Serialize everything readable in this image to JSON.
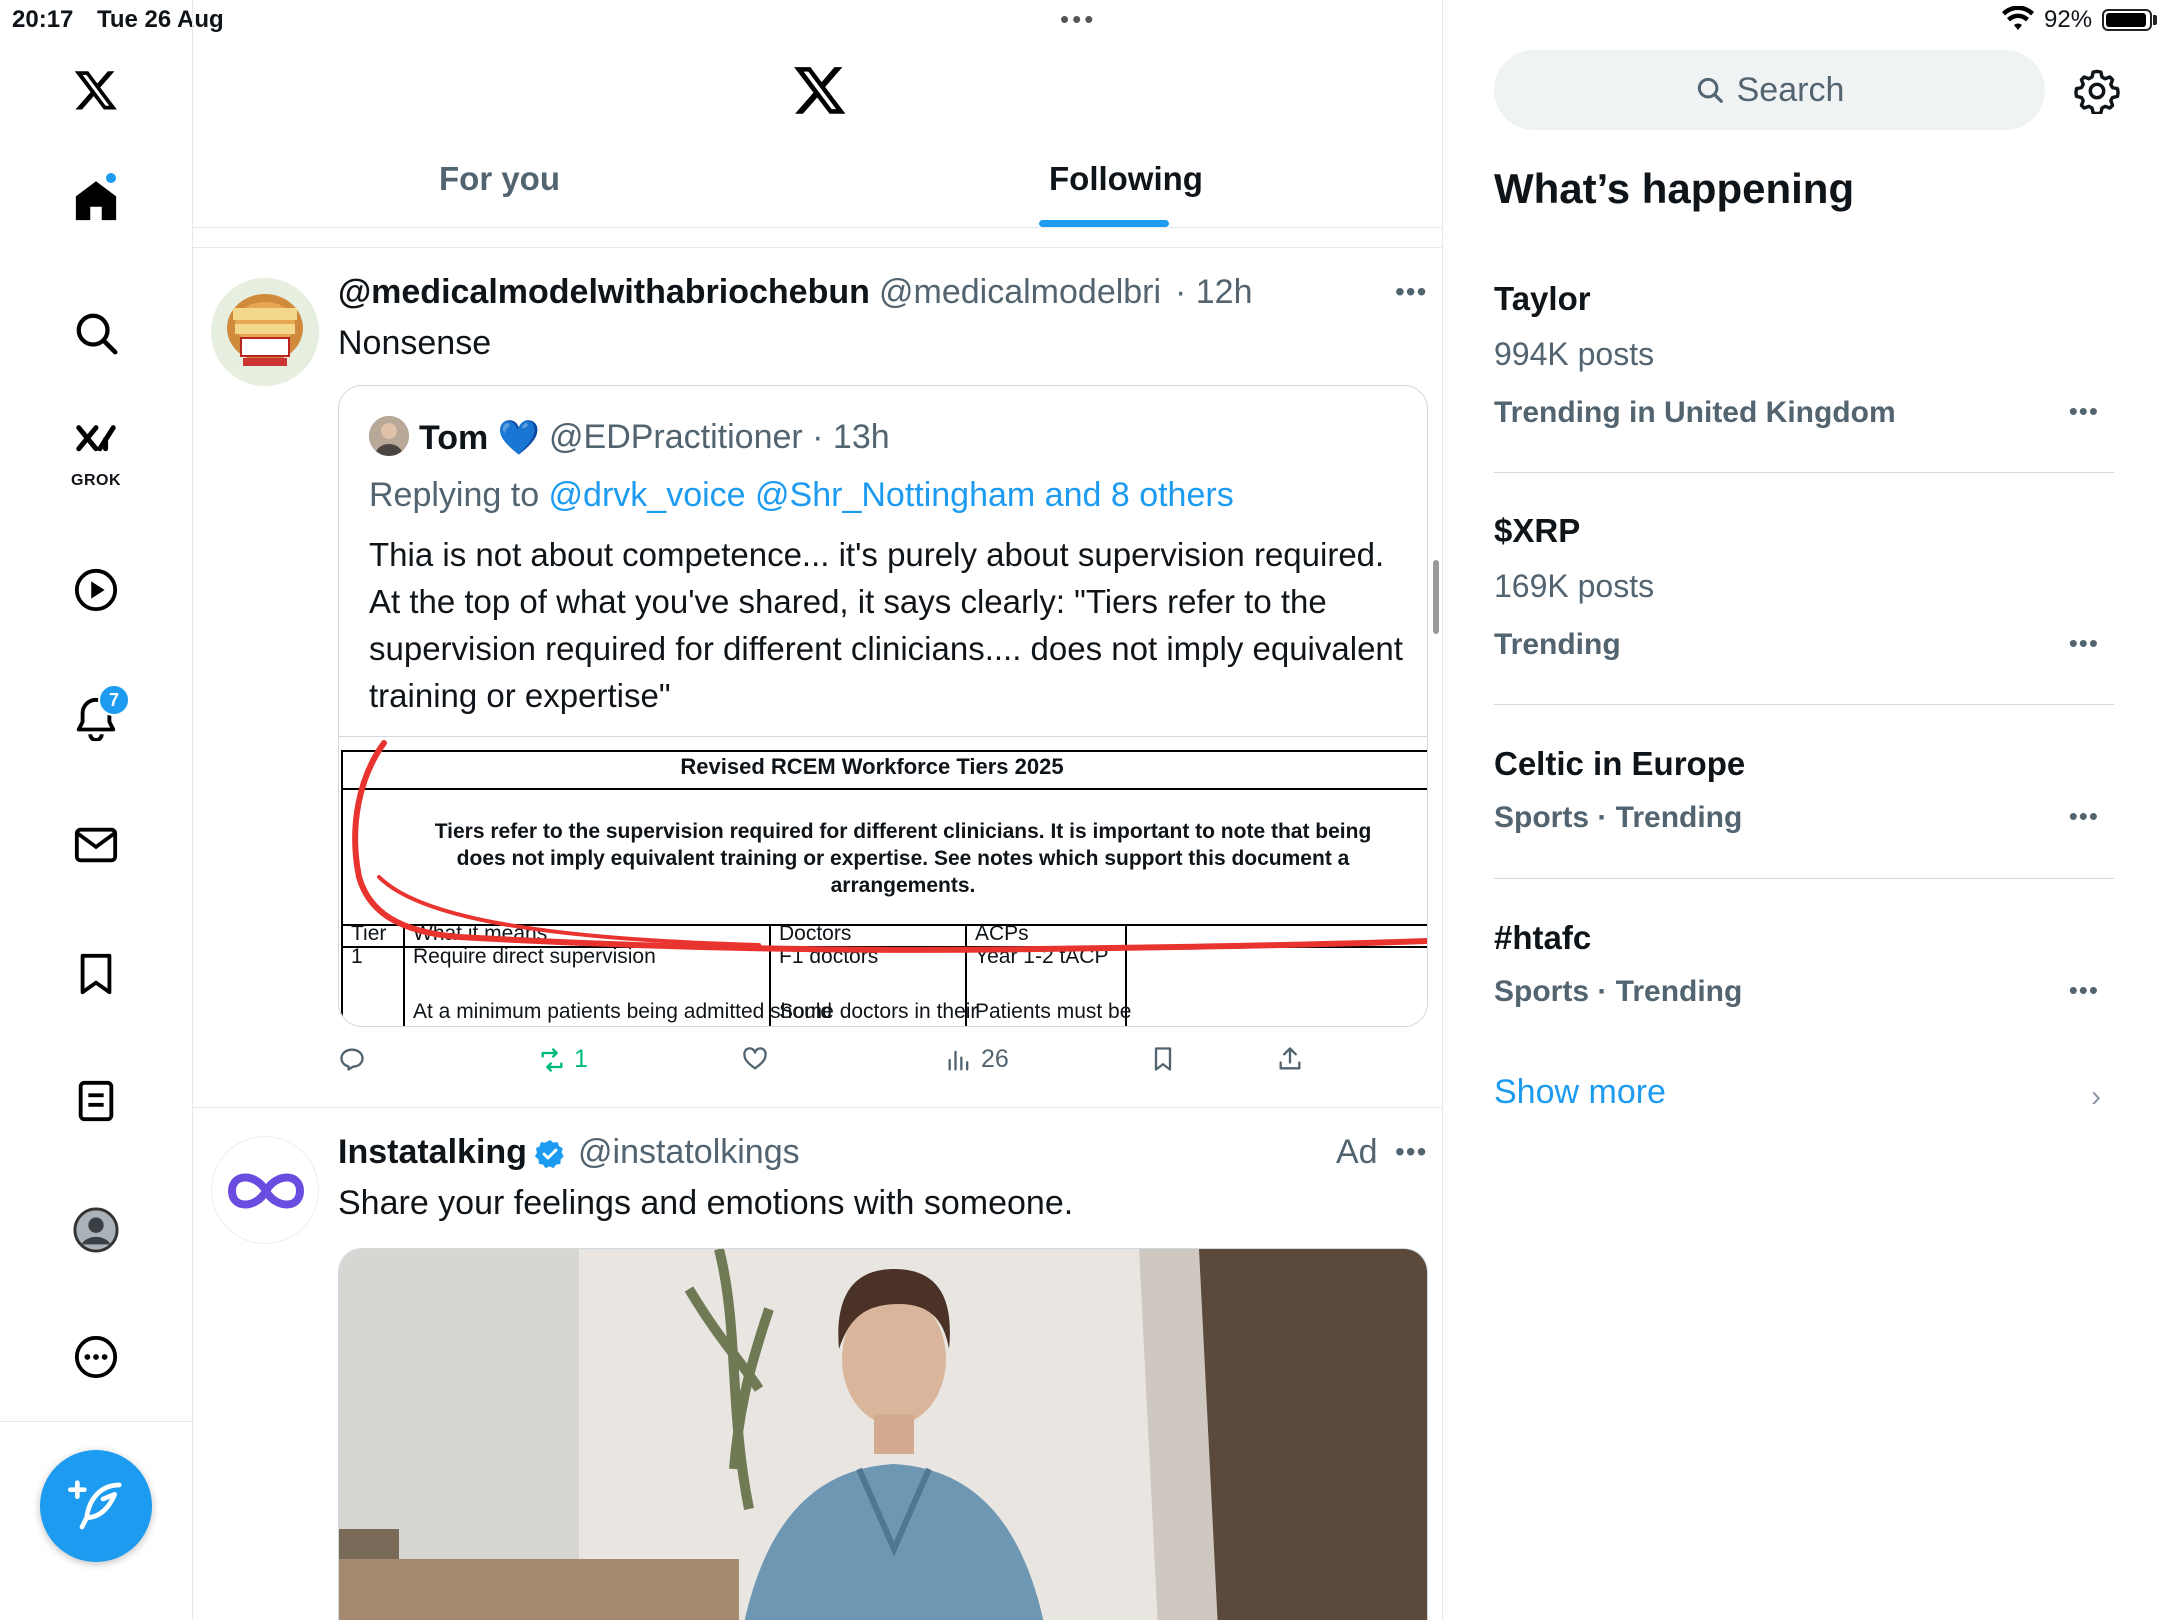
{
  "status_bar": {
    "time": "20:17",
    "date": "Tue 26 Aug",
    "battery": "92%"
  },
  "nav": {
    "grok_label": "GROK",
    "notifications_count": "7"
  },
  "tabs": [
    {
      "label": "For you"
    },
    {
      "label": "Following"
    }
  ],
  "post1": {
    "display_name": "@medicalmodelwithabriochebun",
    "handle": "@medicalmodelbri",
    "time": "· 12h",
    "text": "Nonsense",
    "quote": {
      "name": "Tom",
      "emoji": "💙",
      "handle": "@EDPractitioner · 13h",
      "replying_prefix": "Replying to ",
      "replying_mentions": "@drvk_voice @Shr_Nottingham and 8 others",
      "body": "Thia is not about competence... it's purely about supervision required. At the top of what you've shared, it says clearly: \"Tiers refer to the supervision required for different clinicians.... does not imply equivalent training or expertise\"",
      "doc": {
        "title": "Revised RCEM Workforce Tiers 2025",
        "note_line1": "Tiers refer to the supervision required for different clinicians. It is important to note that being",
        "note_line2": "does not imply equivalent training or expertise. See notes which support this document a",
        "note_line3": "arrangements.",
        "col_tier": "Tier",
        "col_means": "What it means",
        "col_doctors": "Doctors",
        "col_acps": "ACPs",
        "row1_tier": "1",
        "row1_means": "Require direct supervision",
        "row1_doctors": "F1 doctors",
        "row1_acps": "Year 1-2 tACP",
        "row2_means": "At a minimum patients being admitted should",
        "row2_doctors": "Some doctors in their",
        "row2_acps": "Patients must be"
      }
    },
    "stats": {
      "replies": "",
      "reposts": "1",
      "likes": "",
      "views": "26"
    }
  },
  "post2": {
    "display_name": "Instatalking",
    "handle": "@instatolkings",
    "ad_label": "Ad",
    "text": "Share your feelings and emotions with someone."
  },
  "right": {
    "search_placeholder": "Search",
    "section_title": "What’s happening",
    "trends": [
      {
        "title": "Taylor",
        "posts": "994K posts",
        "meta": "Trending in United Kingdom"
      },
      {
        "title": "$XRP",
        "posts": "169K posts",
        "meta": "Trending"
      },
      {
        "title": "Celtic in Europe",
        "posts": "",
        "meta": "Sports · Trending"
      },
      {
        "title": "#htafc",
        "posts": "",
        "meta": "Sports · Trending"
      }
    ],
    "show_more": "Show more"
  },
  "colors": {
    "accent": "#1d9bf0",
    "repost_green": "#00ba7c",
    "annotation_red": "#e8332f"
  },
  "icons": [
    "x-logo-icon",
    "home-icon",
    "search-icon",
    "grok-icon",
    "video-icon",
    "bell-icon",
    "mail-icon",
    "bookmark-icon",
    "lists-icon",
    "profile-icon",
    "more-icon",
    "compose-icon",
    "gear-icon",
    "reply-icon",
    "repost-icon",
    "like-icon",
    "views-icon",
    "share-icon",
    "verified-icon",
    "chevron-right-icon"
  ]
}
